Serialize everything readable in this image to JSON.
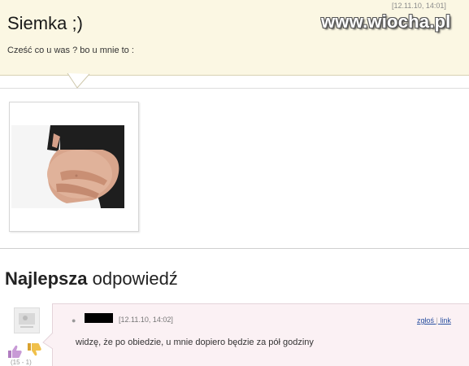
{
  "question": {
    "title": "Siemka ;)",
    "timestamp": "[12.11.10, 14:01]",
    "body": "Cześć co u was ? bo u mnie to :"
  },
  "watermark": "www.wiocha.pl",
  "attachment": {
    "image": "pregnant-belly-photo"
  },
  "best_answer": {
    "heading_bold": "Najlepsza",
    "heading_rest": " odpowiedź",
    "timestamp": "[12.11.10, 14:02]",
    "report_link": "zgłoś",
    "link_link": "link",
    "text": "widzę, że po obiedzie, u mnie dopiero będzie za pół godziny",
    "votes": "(15 - 1)"
  },
  "colors": {
    "question_bg": "#fbf7e3",
    "answer_bg": "#fbf1f4",
    "link": "#2a50a0"
  }
}
